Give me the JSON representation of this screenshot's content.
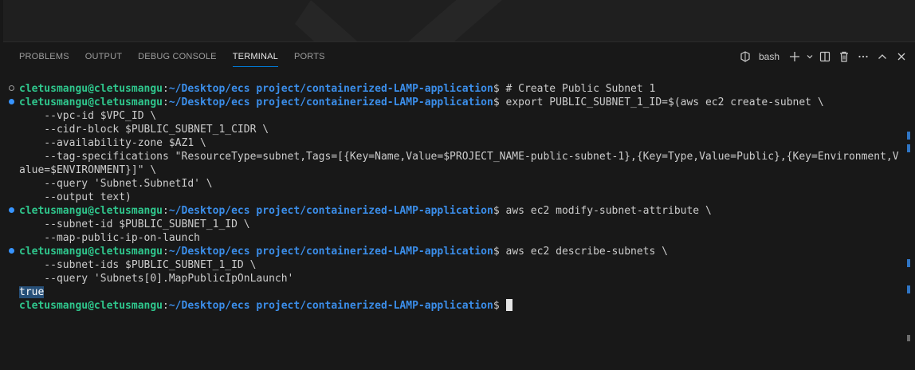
{
  "panel": {
    "tabs": [
      {
        "label": "PROBLEMS"
      },
      {
        "label": "OUTPUT"
      },
      {
        "label": "DEBUG CONSOLE"
      },
      {
        "label": "TERMINAL"
      },
      {
        "label": "PORTS"
      }
    ],
    "active_tab": "TERMINAL",
    "shell_label": "bash",
    "icons": [
      "terminal-profile-icon",
      "new-terminal-plus-icon",
      "chevron-down-icon",
      "split-terminal-icon",
      "trash-icon",
      "more-actions-icon",
      "maximize-panel-icon",
      "close-icon"
    ]
  },
  "terminal": {
    "prompt_user": "cletusmangu@cletusmangu",
    "prompt_path": "~/Desktop/ecs project/containerized-LAMP-application",
    "lines": [
      {
        "prompt": true,
        "status": "empty",
        "text": " # Create Public Subnet 1"
      },
      {
        "prompt": true,
        "status": "filled",
        "text": " export PUBLIC_SUBNET_1_ID=$(aws ec2 create-subnet \\"
      },
      {
        "text": "    --vpc-id $VPC_ID \\"
      },
      {
        "text": "    --cidr-block $PUBLIC_SUBNET_1_CIDR \\"
      },
      {
        "text": "    --availability-zone $AZ1 \\"
      },
      {
        "text": "    --tag-specifications \"ResourceType=subnet,Tags=[{Key=Name,Value=$PROJECT_NAME-public-subnet-1},{Key=Type,Value=Public},{Key=Environment,V"
      },
      {
        "text": "alue=$ENVIRONMENT}]\" \\"
      },
      {
        "text": "    --query 'Subnet.SubnetId' \\"
      },
      {
        "text": "    --output text)"
      },
      {
        "prompt": true,
        "status": "filled",
        "text": " aws ec2 modify-subnet-attribute \\"
      },
      {
        "text": "    --subnet-id $PUBLIC_SUBNET_1_ID \\"
      },
      {
        "text": "    --map-public-ip-on-launch"
      },
      {
        "prompt": true,
        "status": "filled",
        "text": " aws ec2 describe-subnets \\"
      },
      {
        "text": "    --subnet-ids $PUBLIC_SUBNET_1_ID \\"
      },
      {
        "text": "    --query 'Subnets[0].MapPublicIpOnLaunch'"
      },
      {
        "text": "true",
        "selected": true
      },
      {
        "prompt": true,
        "status": "none",
        "text": " ",
        "cursor": true
      }
    ]
  },
  "colors": {
    "accent": "#0078d4",
    "user": "#2fc78d",
    "path": "#3b8eea",
    "decoration": "#3794ff",
    "selection": "#264f78"
  }
}
